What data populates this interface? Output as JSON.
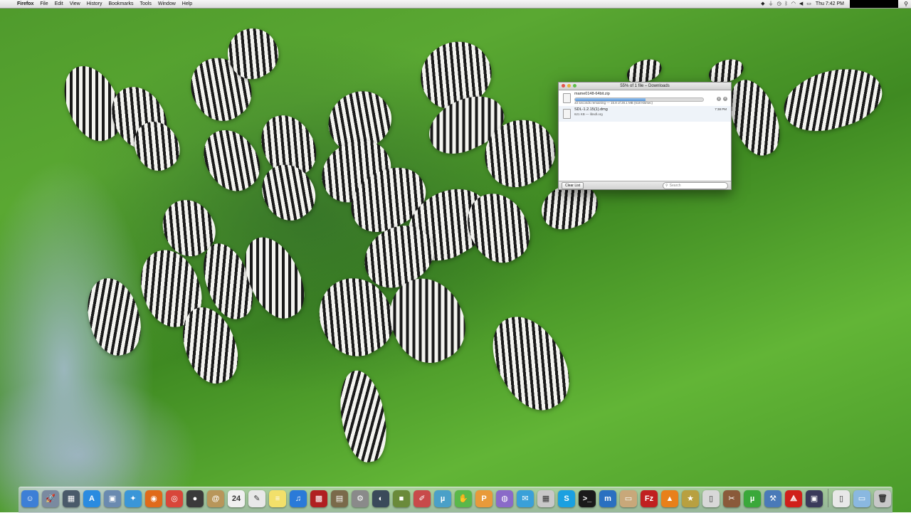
{
  "menubar": {
    "app_name": "Firefox",
    "menus": [
      "File",
      "Edit",
      "View",
      "History",
      "Bookmarks",
      "Tools",
      "Window",
      "Help"
    ],
    "clock": "Thu 7:42 PM",
    "status_icons": [
      "dropbox-icon",
      "usb-icon",
      "time-machine-icon",
      "bluetooth-icon",
      "wifi-icon",
      "volume-icon",
      "battery-icon"
    ]
  },
  "downloads": {
    "title": "55% of 1 file – Downloads",
    "items": [
      {
        "name": "mame0148-64bit.zip",
        "status": "33 seconds remaining — 15.8 of 28.1 MB (618 KB/sec)",
        "progress": 0.55
      },
      {
        "name": "SDL-1.2.15(1).dmg",
        "status": "621 KB — libsdl.org",
        "time": "7:38 PM"
      }
    ],
    "clear_label": "Clear List",
    "search_placeholder": "Search"
  },
  "dock": {
    "apps": [
      {
        "name": "finder",
        "glyph": "☺",
        "color": "#3d7fd6"
      },
      {
        "name": "launchpad",
        "glyph": "🚀",
        "color": "#7a8aa0"
      },
      {
        "name": "mission-control",
        "glyph": "▦",
        "color": "#4a5a6a"
      },
      {
        "name": "app-store",
        "glyph": "A",
        "color": "#2a8be0"
      },
      {
        "name": "preview",
        "glyph": "▣",
        "color": "#6a8ab0"
      },
      {
        "name": "safari",
        "glyph": "✦",
        "color": "#3a96d8"
      },
      {
        "name": "firefox",
        "glyph": "◉",
        "color": "#e06a1a"
      },
      {
        "name": "chrome",
        "glyph": "◎",
        "color": "#d8463a"
      },
      {
        "name": "camera",
        "glyph": "●",
        "color": "#3a3a3a"
      },
      {
        "name": "contacts",
        "glyph": "@",
        "color": "#b8965a"
      },
      {
        "name": "calendar",
        "glyph": "24",
        "color": "#f0f0f0"
      },
      {
        "name": "textedit",
        "glyph": "✎",
        "color": "#e8e8e8"
      },
      {
        "name": "stickies",
        "glyph": "≡",
        "color": "#f2e06a"
      },
      {
        "name": "itunes",
        "glyph": "♫",
        "color": "#2a7ad8"
      },
      {
        "name": "photo-booth",
        "glyph": "▩",
        "color": "#b02020"
      },
      {
        "name": "image-capture",
        "glyph": "▤",
        "color": "#7a6a4a"
      },
      {
        "name": "system-preferences",
        "glyph": "⚙",
        "color": "#8a8a8a"
      },
      {
        "name": "steam",
        "glyph": "◐",
        "color": "#3a4a5a"
      },
      {
        "name": "minecraft",
        "glyph": "■",
        "color": "#6a8a3a"
      },
      {
        "name": "paintbrush",
        "glyph": "✐",
        "color": "#c84a4a"
      },
      {
        "name": "utorrent-alt",
        "glyph": "µ",
        "color": "#4aa0c8"
      },
      {
        "name": "hands-off",
        "glyph": "✋",
        "color": "#5ab84a"
      },
      {
        "name": "pages",
        "glyph": "P",
        "color": "#e89a3a"
      },
      {
        "name": "teamspeak",
        "glyph": "◍",
        "color": "#8a6ac8"
      },
      {
        "name": "messages",
        "glyph": "✉",
        "color": "#3aa0d8"
      },
      {
        "name": "calculator",
        "glyph": "▦",
        "color": "#c8c8c8"
      },
      {
        "name": "skype",
        "glyph": "S",
        "color": "#1aa0e0"
      },
      {
        "name": "terminal",
        "glyph": ">_",
        "color": "#1a1a1a"
      },
      {
        "name": "moneydance",
        "glyph": "m",
        "color": "#2a70c0"
      },
      {
        "name": "archive-utility",
        "glyph": "▭",
        "color": "#c8a87a"
      },
      {
        "name": "filezilla",
        "glyph": "Fz",
        "color": "#c02020"
      },
      {
        "name": "vlc",
        "glyph": "▲",
        "color": "#e8801a"
      },
      {
        "name": "pinball",
        "glyph": "★",
        "color": "#b8a040"
      },
      {
        "name": "usb-overdrive",
        "glyph": "▯",
        "color": "#d8d8d8"
      },
      {
        "name": "tools",
        "glyph": "✂",
        "color": "#8a5a3a"
      },
      {
        "name": "utorrent",
        "glyph": "µ",
        "color": "#3aa83a"
      },
      {
        "name": "xcode",
        "glyph": "⚒",
        "color": "#4a7ab8"
      },
      {
        "name": "acrobat",
        "glyph": "⟁",
        "color": "#d0201a"
      },
      {
        "name": "video-converter",
        "glyph": "▣",
        "color": "#3a3a5a"
      }
    ],
    "stacks": [
      {
        "name": "documents-stack",
        "glyph": "▯",
        "color": "#e8e8e8"
      },
      {
        "name": "downloads-folder",
        "glyph": "▭",
        "color": "#8ab8e0"
      },
      {
        "name": "trash",
        "glyph": "🗑",
        "color": "#c8c8c8"
      }
    ]
  }
}
